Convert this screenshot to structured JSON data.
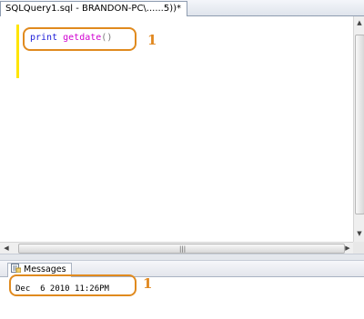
{
  "query_tab": {
    "title": "SQLQuery1.sql - BRANDON-PC\\......5))*"
  },
  "editor": {
    "code_keyword": "print",
    "code_function": "getdate",
    "code_parens": "()"
  },
  "results": {
    "tab_label": "Messages",
    "output": "Dec  6 2010 11:26PM"
  },
  "annotations": {
    "code_number": "1",
    "result_number": "1",
    "accent_color": "#e08a1e"
  },
  "icons": [
    "messages-icon",
    "scroll-arrow-up-icon",
    "scroll-arrow-down-icon",
    "scroll-arrow-left-icon",
    "scroll-arrow-right-icon",
    "scroll-grip-icon"
  ]
}
